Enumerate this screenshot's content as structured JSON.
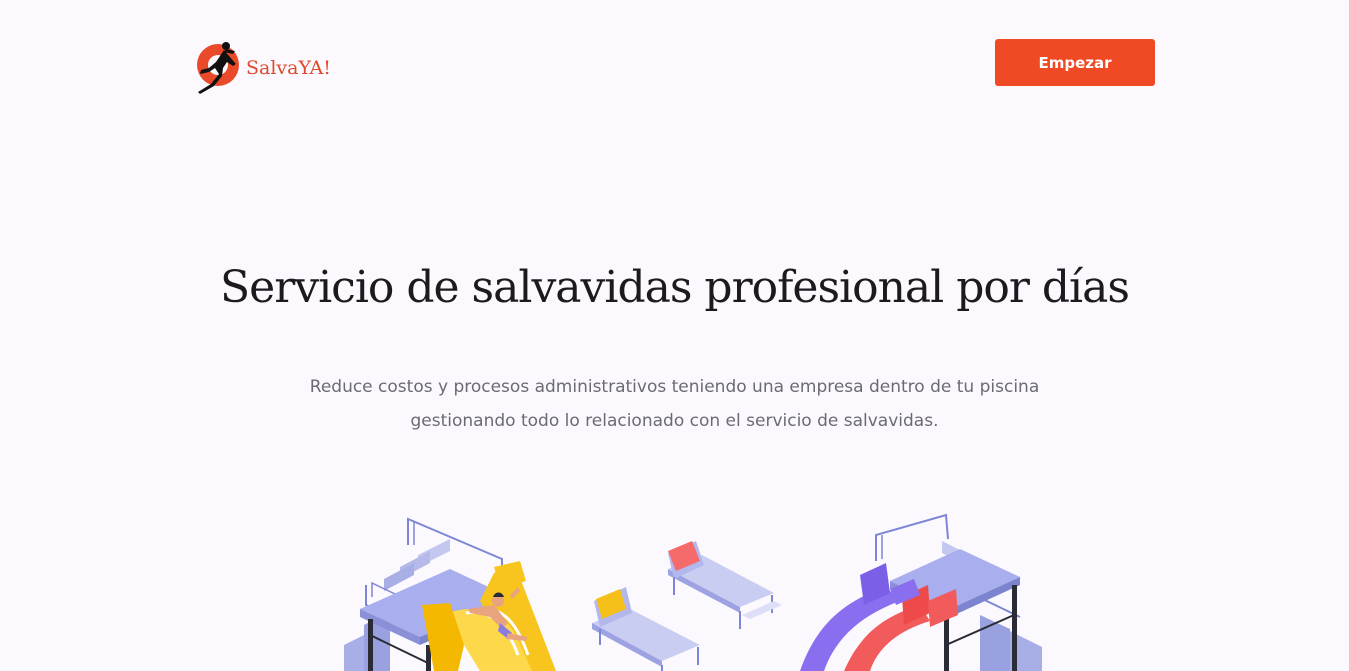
{
  "header": {
    "logo_text": "SalvaYA!",
    "cta_label": "Empezar"
  },
  "hero": {
    "title": "Servicio de salvavidas profesional por días",
    "subtitle_lines": [
      "Reduce costos y procesos administrativos teniendo una empresa dentro de tu piscina",
      "gestionando todo lo relacionado con el servicio de salvavidas."
    ]
  },
  "colors": {
    "background": "#fbf9fd",
    "accent": "#f04a24",
    "logo": "#e0492c",
    "title": "#1c1a1f",
    "subtitle": "#6c6a73"
  },
  "icons": {
    "logo": "lifeguard-running-icon"
  }
}
